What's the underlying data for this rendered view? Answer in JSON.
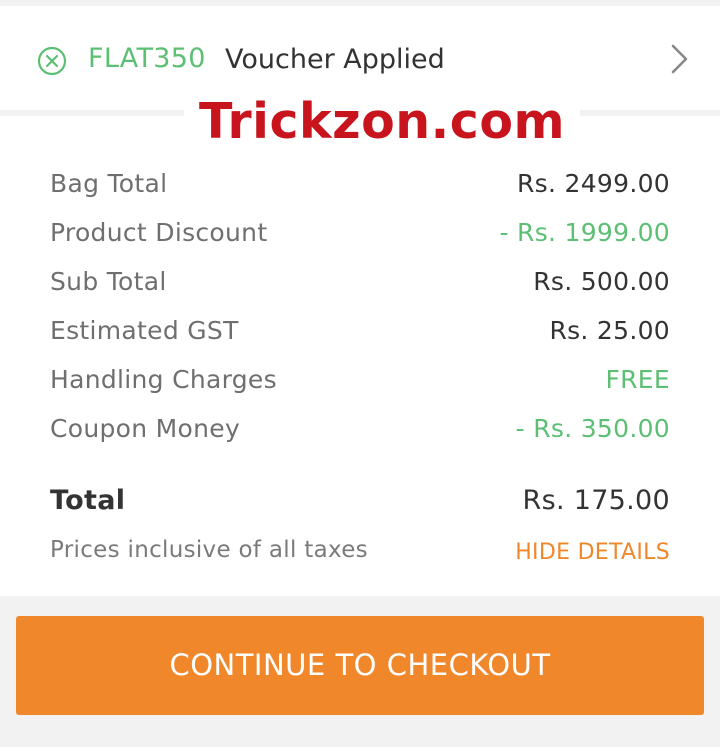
{
  "voucher": {
    "icon": "circle-x-icon",
    "code": "FLAT350",
    "status": "Voucher Applied",
    "chevron_icon": "chevron-right-icon",
    "code_color": "#5dbf73"
  },
  "watermark": {
    "text": "Trickzon.com",
    "color": "#c8141c"
  },
  "summary": {
    "rows": [
      {
        "label": "Bag Total",
        "value": "Rs. 2499.00"
      },
      {
        "label": "Product Discount",
        "value": "- Rs. 1999.00"
      },
      {
        "label": "Sub Total",
        "value": "Rs. 500.00"
      },
      {
        "label": "Estimated GST",
        "value": "Rs. 25.00"
      },
      {
        "label": "Handling Charges",
        "value": "FREE"
      },
      {
        "label": "Coupon Money",
        "value": "- Rs. 350.00"
      }
    ],
    "total": {
      "label": "Total",
      "value": "Rs. 175.00"
    },
    "note": {
      "label": "Prices inclusive of all taxes",
      "action": "HIDE DETAILS"
    }
  },
  "checkout": {
    "label": "CONTINUE TO CHECKOUT",
    "color": "#f0872a"
  },
  "colors": {
    "green": "#5dbf73",
    "orange": "#f0872a",
    "text": "#333333",
    "muted": "#6f6f6f"
  }
}
